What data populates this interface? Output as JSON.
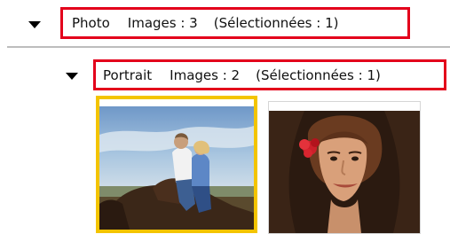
{
  "groups": [
    {
      "name": "Photo",
      "images_label": "Images : 3",
      "selected_label": "(Sélectionnées : 1)"
    },
    {
      "name": "Portrait",
      "images_label": "Images : 2",
      "selected_label": "(Sélectionnées : 1)"
    }
  ],
  "thumbnails": [
    {
      "selected": true,
      "subject": "couple-on-horse"
    },
    {
      "selected": false,
      "subject": "woman-portrait"
    }
  ],
  "colors": {
    "highlight_border": "#e3001b",
    "selection_border": "#f3c400",
    "divider": "#bdbdbd"
  }
}
